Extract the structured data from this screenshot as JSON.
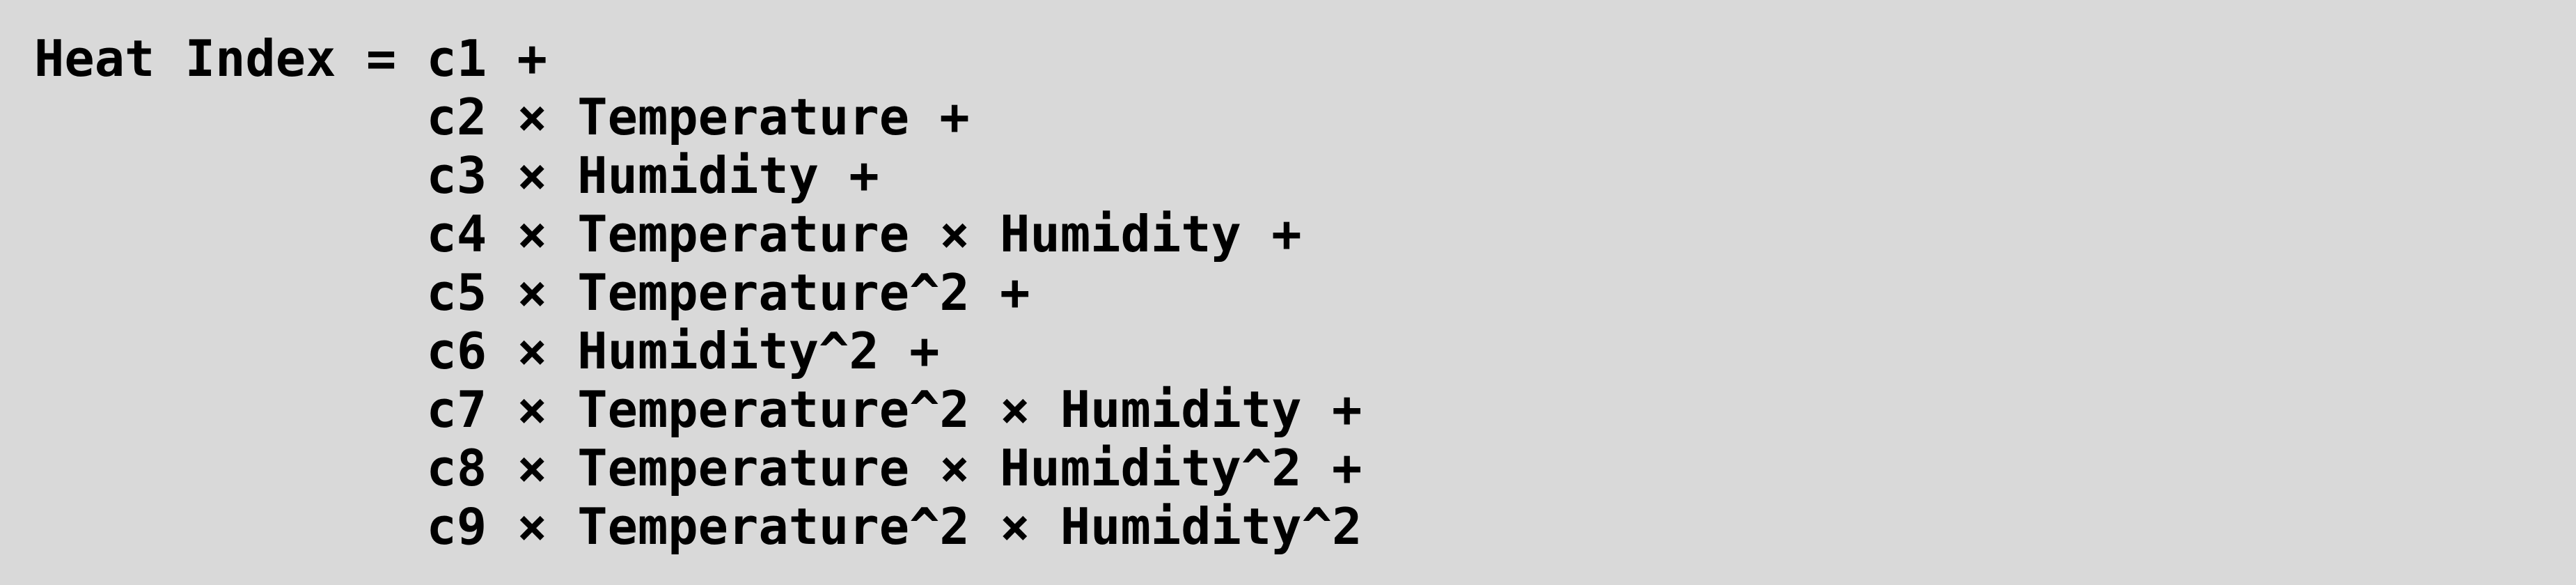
{
  "formula": {
    "lines": [
      "Heat Index = c1 +",
      "             c2 × Temperature +",
      "             c3 × Humidity +",
      "             c4 × Temperature × Humidity +",
      "             c5 × Temperature^2 +",
      "             c6 × Humidity^2 +",
      "             c7 × Temperature^2 × Humidity +",
      "             c8 × Temperature × Humidity^2 +",
      "             c9 × Temperature^2 × Humidity^2"
    ]
  },
  "colors": {
    "background": "#d9d9d9",
    "text": "#000000"
  }
}
